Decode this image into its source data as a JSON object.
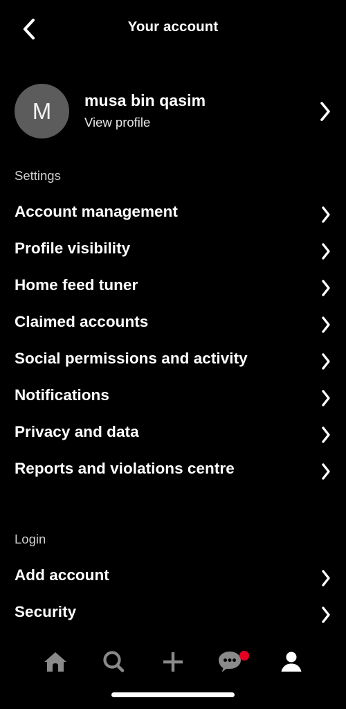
{
  "header": {
    "title": "Your account",
    "back_icon": "chevron-left-icon"
  },
  "profile": {
    "avatar_initial": "M",
    "avatar_color": "#5c5c5c",
    "name": "musa bin qasim",
    "subtitle": "View profile",
    "chevron_icon": "chevron-right-icon"
  },
  "sections": [
    {
      "label": "Settings",
      "items": [
        {
          "label": "Account management",
          "chevron_icon": "chevron-right-icon"
        },
        {
          "label": "Profile visibility",
          "chevron_icon": "chevron-right-icon"
        },
        {
          "label": "Home feed tuner",
          "chevron_icon": "chevron-right-icon"
        },
        {
          "label": "Claimed accounts",
          "chevron_icon": "chevron-right-icon"
        },
        {
          "label": "Social permissions and activity",
          "chevron_icon": "chevron-right-icon"
        },
        {
          "label": "Notifications",
          "chevron_icon": "chevron-right-icon"
        },
        {
          "label": "Privacy and data",
          "chevron_icon": "chevron-right-icon"
        },
        {
          "label": "Reports and violations centre",
          "chevron_icon": "chevron-right-icon"
        }
      ]
    },
    {
      "label": "Login",
      "items": [
        {
          "label": "Add account",
          "chevron_icon": "chevron-right-icon"
        },
        {
          "label": "Security",
          "chevron_icon": "chevron-right-icon"
        }
      ]
    }
  ],
  "bottom_nav": {
    "items": [
      {
        "icon": "home-icon",
        "active": false,
        "badge": false
      },
      {
        "icon": "search-icon",
        "active": false,
        "badge": false
      },
      {
        "icon": "plus-icon",
        "active": false,
        "badge": false
      },
      {
        "icon": "chat-icon",
        "active": true,
        "badge": true
      },
      {
        "icon": "profile-icon",
        "active": true,
        "badge": false
      }
    ],
    "badge_color": "#e60023",
    "inactive_color": "#8a8a8a",
    "active_color": "#ffffff"
  },
  "system": {
    "home_indicator": "home-indicator-bar"
  }
}
